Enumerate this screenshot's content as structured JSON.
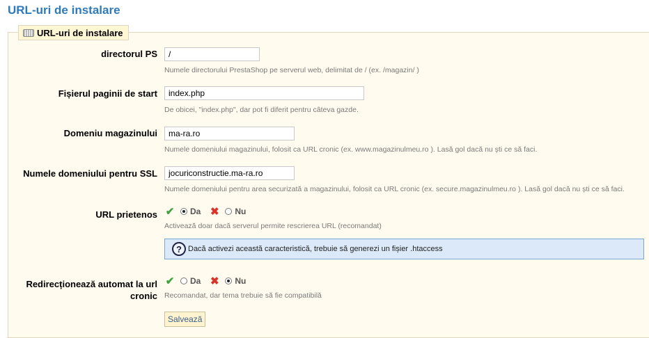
{
  "page": {
    "title": "URL-uri de instalare"
  },
  "panel": {
    "legend": "URL-uri de instalare",
    "legend_icon": "keyboard-icon"
  },
  "fields": {
    "ps_dir": {
      "label": "directorul PS",
      "value": "/",
      "hint": "Numele directorului PrestaShop pe serverul web, delimitat de / (ex. /magazin/ )"
    },
    "start_page": {
      "label": "Fișierul paginii de start",
      "value": "index.php",
      "hint": "De obicei, \"index.php\", dar pot fi diferit pentru câteva gazde."
    },
    "shop_domain": {
      "label": "Domeniu magazinului",
      "value": "ma-ra.ro",
      "hint": "Numele domeniului magazinului, folosit ca URL cronic (ex. www.magazinulmeu.ro ). Lasă gol dacă nu ști ce să faci."
    },
    "ssl_domain": {
      "label": "Numele domeniului pentru SSL",
      "value": "jocuriconstructie.ma-ra.ro",
      "hint": "Numele domeniului pentru area securizată a magazinului, folosit ca URL cronic (ex. secure.magazinulmeu.ro ). Lasă gol dacă nu ști ce să faci."
    },
    "friendly_url": {
      "label": "URL prietenos",
      "yes_label": "Da",
      "no_label": "Nu",
      "selected": "Da",
      "hint": "Activează doar dacă serverul permite rescrierea URL (recomandat)",
      "info": "Dacă activezi această caracteristică, trebuie să generezi un fișier .htaccess"
    },
    "canonical_redirect": {
      "label_line1": "Redirecționează automat la url",
      "label_line2": "cronic",
      "yes_label": "Da",
      "no_label": "Nu",
      "selected": "Nu",
      "hint": "Recomandat, dar tema trebuie să fie compatibilă"
    }
  },
  "actions": {
    "save_label": "Salvează"
  },
  "colors": {
    "accent": "#2f7ab8",
    "panel_bg": "#fffbee",
    "info_bg": "#dbe9f8",
    "yes": "#3da33d",
    "no": "#d9342b"
  }
}
